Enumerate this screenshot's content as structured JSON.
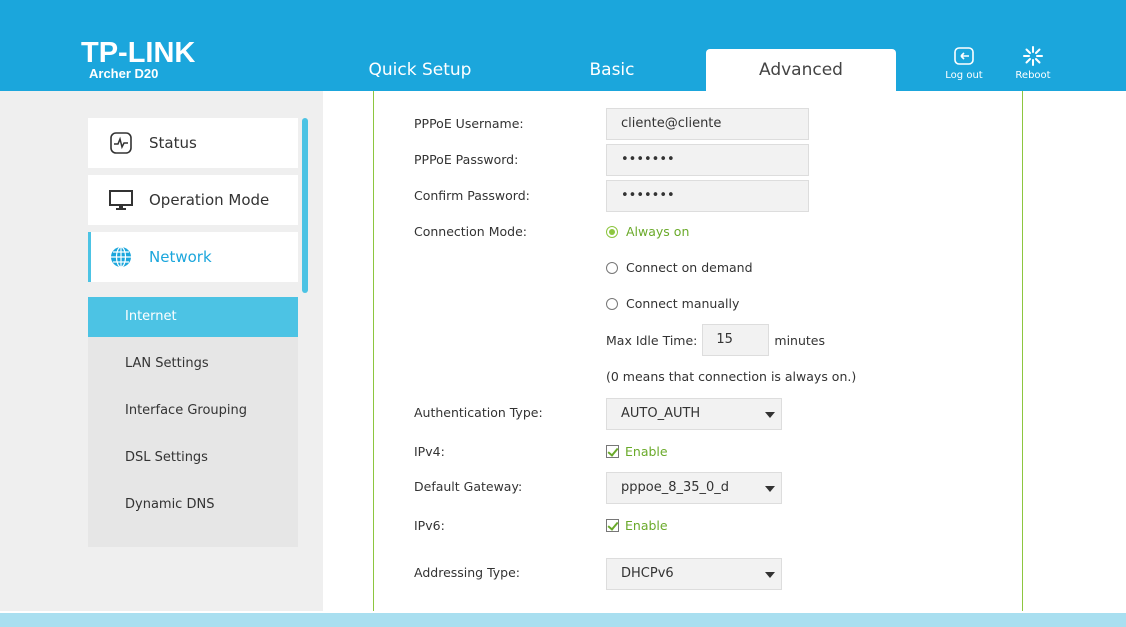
{
  "header": {
    "logo": "TP-LINK",
    "model": "Archer D20",
    "tabs": [
      "Quick Setup",
      "Basic",
      "Advanced"
    ],
    "active_tab": "Advanced",
    "logout_label": "Log out",
    "reboot_label": "Reboot",
    "bg_color": "#1ba6dc"
  },
  "sidebar": {
    "items": [
      {
        "label": "Status",
        "icon": "status-icon"
      },
      {
        "label": "Operation Mode",
        "icon": "monitor-icon"
      },
      {
        "label": "Network",
        "icon": "globe-icon"
      }
    ],
    "submenu": [
      "Internet",
      "LAN Settings",
      "Interface Grouping",
      "DSL Settings",
      "Dynamic DNS"
    ],
    "active_submenu": "Internet"
  },
  "form": {
    "username_label": "PPPoE Username:",
    "username_value": "cliente@cliente",
    "password_label": "PPPoE Password:",
    "password_value": "•••••••",
    "confirm_label": "Confirm Password:",
    "confirm_value": "•••••••",
    "connection_mode_label": "Connection Mode:",
    "modes": [
      "Always on",
      "Connect on demand",
      "Connect manually"
    ],
    "selected_mode": "Always on",
    "max_idle_label": "Max Idle Time:",
    "max_idle_value": "15",
    "max_idle_unit": "minutes",
    "idle_note": "(0 means that connection is always on.)",
    "auth_label": "Authentication Type:",
    "auth_value": "AUTO_AUTH",
    "ipv4_label": "IPv4:",
    "ipv4_check": "Enable",
    "gateway_label": "Default Gateway:",
    "gateway_value": "pppoe_8_35_0_d",
    "ipv6_label": "IPv6:",
    "ipv6_check": "Enable",
    "addressing_label": "Addressing Type:",
    "addressing_value": "DHCPv6"
  }
}
